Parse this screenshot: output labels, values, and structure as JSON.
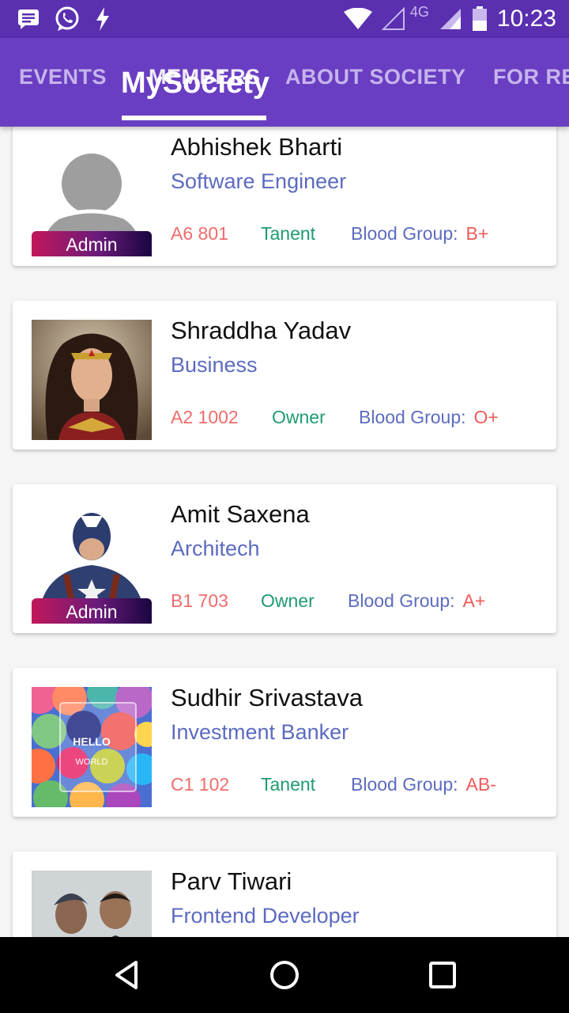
{
  "status_bar": {
    "time": "10:23",
    "network_type": "4G",
    "left_icons": [
      "message-icon",
      "whatsapp-icon",
      "flash-icon"
    ],
    "right_icons": [
      "wifi-icon",
      "signal-icon",
      "battery-icon"
    ]
  },
  "header": {
    "app_title": "MySociety",
    "tabs": [
      {
        "label": "EVENTS",
        "active": false
      },
      {
        "label": "MEMBERS",
        "active": true
      },
      {
        "label": "ABOUT SOCIETY",
        "active": false
      },
      {
        "label": "FOR RE",
        "active": false
      }
    ]
  },
  "members": [
    {
      "name": "Abhishek Bharti",
      "profession": "Software Engineer",
      "flat": "A6 801",
      "role": "Tanent",
      "blood_group_label": "Blood Group:",
      "blood_group": "B+",
      "admin": true,
      "admin_label": "Admin",
      "avatar": "placeholder-avatar"
    },
    {
      "name": "Shraddha Yadav",
      "profession": "Business",
      "flat": "A2 1002",
      "role": "Owner",
      "blood_group_label": "Blood Group:",
      "blood_group": "O+",
      "admin": false,
      "avatar": "wonder-woman-photo"
    },
    {
      "name": "Amit Saxena",
      "profession": "Architech",
      "flat": "B1 703",
      "role": "Owner",
      "blood_group_label": "Blood Group:",
      "blood_group": "A+",
      "admin": true,
      "admin_label": "Admin",
      "avatar": "captain-america-photo"
    },
    {
      "name": "Sudhir Srivastava",
      "profession": "Investment Banker",
      "flat": "C1 102",
      "role": "Tanent",
      "blood_group_label": "Blood Group:",
      "blood_group": "AB-",
      "admin": false,
      "avatar": "hello-world-image",
      "avatar_text_1": "HELLO",
      "avatar_text_2": "WORLD"
    },
    {
      "name": "Parv Tiwari",
      "profession": "Frontend Developer",
      "admin": false,
      "avatar": "two-men-photo"
    }
  ],
  "colors": {
    "status_bar": "#5a2fb0",
    "tab_bar": "#6a3ec2",
    "profession": "#5c6bc0",
    "flat": "#ef6c6c",
    "role": "#1e9c6e",
    "blood_group": "#ef5a5a"
  }
}
